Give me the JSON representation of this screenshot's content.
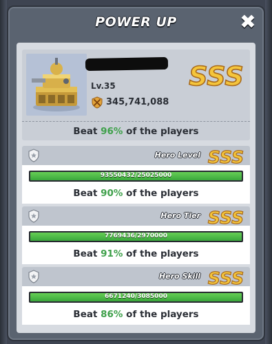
{
  "dialog": {
    "title": "POWER UP"
  },
  "hero": {
    "level": "Lv.35",
    "power": "345,741,088",
    "rank": "SSS",
    "beat_prefix": "Beat",
    "beat_percent": "96%",
    "beat_suffix": "of the players"
  },
  "stats": [
    {
      "label": "Hero Level",
      "rank": "SSS",
      "progress_text": "93550432/25025000",
      "fill_fraction": 1.0,
      "beat_prefix": "Beat",
      "beat_percent": "90%",
      "beat_suffix": "of the players"
    },
    {
      "label": "Hero Tier",
      "rank": "SSS",
      "progress_text": "7769436/2970000",
      "fill_fraction": 1.0,
      "beat_prefix": "Beat",
      "beat_percent": "91%",
      "beat_suffix": "of the players"
    },
    {
      "label": "Hero Skill",
      "rank": "SSS",
      "progress_text": "6671240/3085000",
      "fill_fraction": 1.0,
      "beat_prefix": "Beat",
      "beat_percent": "86%",
      "beat_suffix": "of the players"
    }
  ],
  "colors": {
    "accent_green": "#3ea04a",
    "rank_gold": "#f2c23a"
  },
  "icons": {
    "close": "close-icon",
    "power": "crossed-swords-icon",
    "medal": "medal-icon"
  }
}
